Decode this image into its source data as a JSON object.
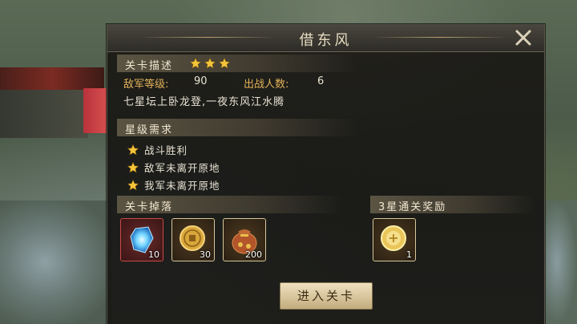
{
  "dialog": {
    "title": "借东风",
    "close_icon": "close-icon"
  },
  "stage_desc": {
    "header": "关卡描述",
    "stars_earned": 3,
    "enemy_level_label": "敌军等级:",
    "enemy_level": "90",
    "troops_label": "出战人数:",
    "troops": "6",
    "description": "七星坛上卧龙登,一夜东风江水腾"
  },
  "star_requirements": {
    "header": "星级需求",
    "items": [
      {
        "label": "战斗胜利",
        "icon": "star-icon"
      },
      {
        "label": "敌军未离开原地",
        "icon": "star-icon"
      },
      {
        "label": "我军未离开原地",
        "icon": "star-icon"
      }
    ]
  },
  "drops": {
    "header": "关卡掉落",
    "items": [
      {
        "icon": "blue-crystal-icon",
        "qty": "10"
      },
      {
        "icon": "gold-coin-icon",
        "qty": "30"
      },
      {
        "icon": "money-bag-icon",
        "qty": "200"
      }
    ]
  },
  "reward": {
    "header": "3星通关奖励",
    "items": [
      {
        "icon": "gold-token-icon",
        "qty": "1"
      }
    ]
  },
  "enter_button": "进入关卡",
  "colors": {
    "gold_text": "#e3b25a",
    "star": "#f4c43a",
    "header_bg": "#5b5443"
  }
}
